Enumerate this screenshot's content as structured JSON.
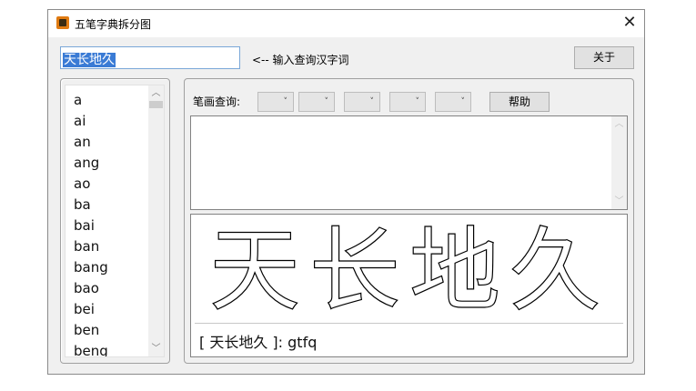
{
  "window": {
    "title": "五笔字典拆分图",
    "close_symbol": "✕"
  },
  "search": {
    "value": "天长地久",
    "hint": "<-- 输入查询汉字词"
  },
  "buttons": {
    "about": "关于",
    "help": "帮助"
  },
  "pinyin_list": [
    "a",
    "ai",
    "an",
    "ang",
    "ao",
    "ba",
    "bai",
    "ban",
    "bang",
    "bao",
    "bei",
    "ben",
    "beng"
  ],
  "stroke_query": {
    "label": "笔画查询:",
    "combo_arrow": "˅",
    "combo_count": 5
  },
  "glyphs": {
    "characters": [
      "天",
      "长",
      "地",
      "久"
    ]
  },
  "code_line": {
    "text": "[ 天长地久 ]:  gtfq"
  },
  "icons": {
    "app": "app-logo-icon",
    "close": "close-icon",
    "scroll_up": "chevron-up-icon",
    "scroll_down": "chevron-down-icon",
    "combo": "chevron-down-icon"
  },
  "colors": {
    "selection": "#3a7bd5",
    "glyph_fill": "#000000"
  }
}
